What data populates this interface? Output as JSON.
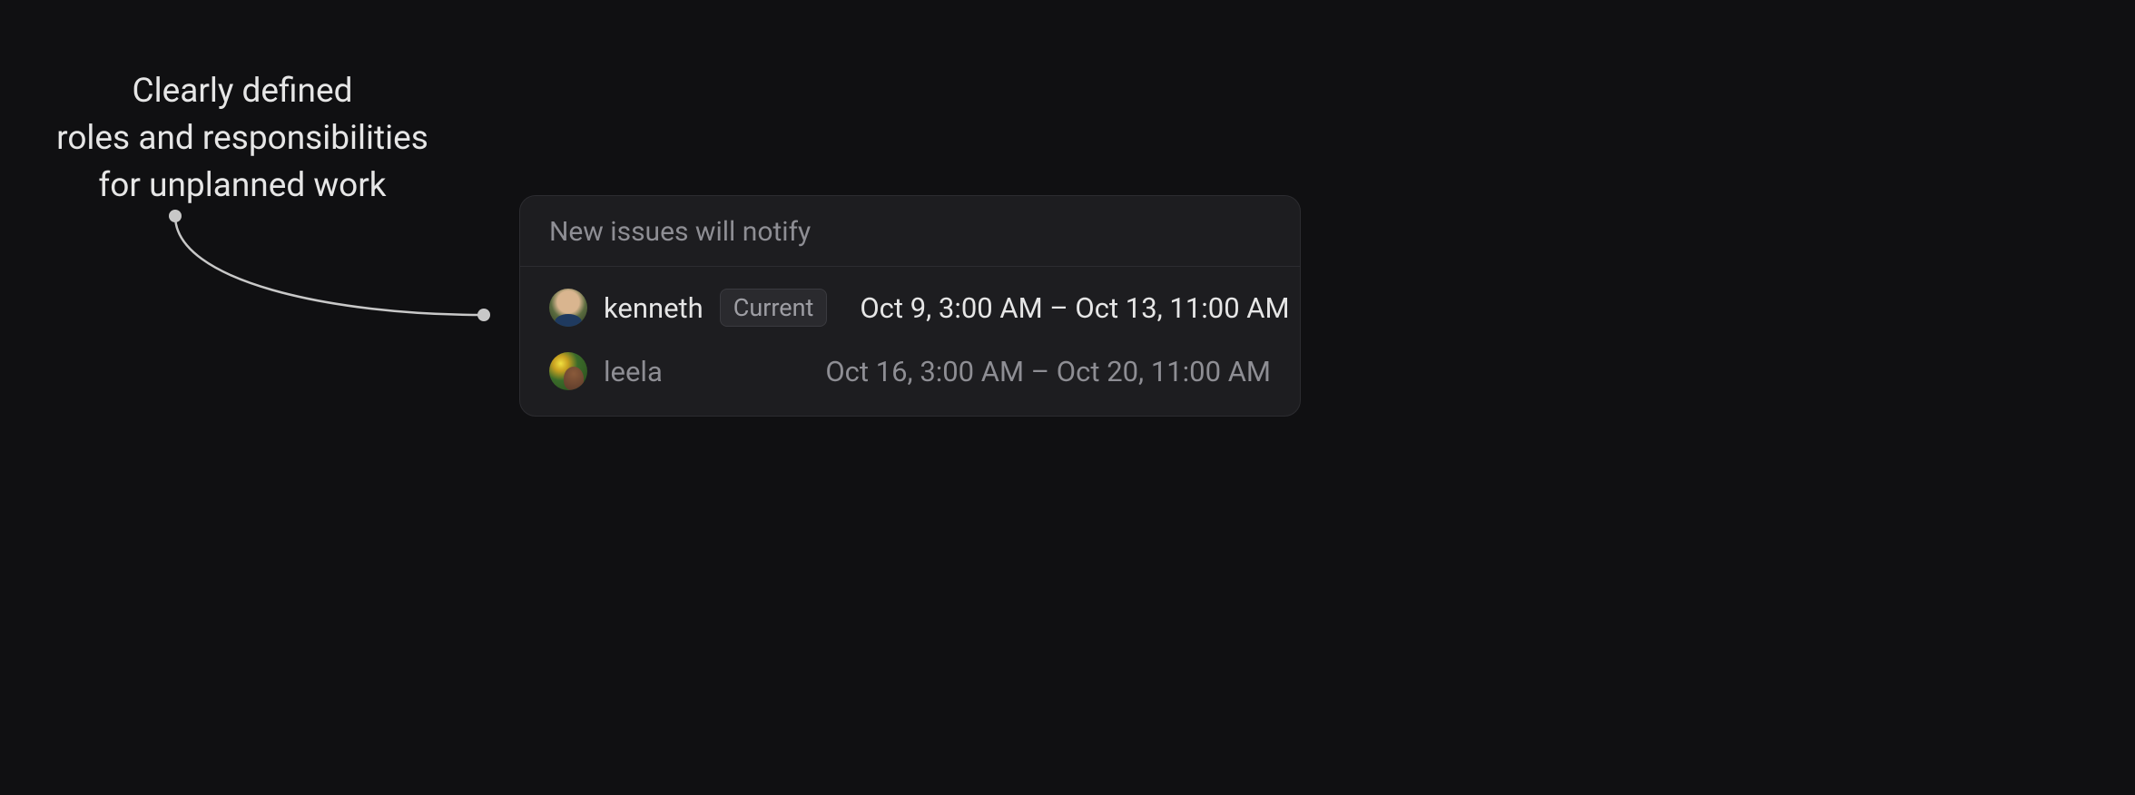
{
  "annotation": {
    "line1": "Clearly defined",
    "line2": "roles and responsibilities",
    "line3": "for unplanned work"
  },
  "panel": {
    "header": "New issues will notify",
    "rows": [
      {
        "avatar": "kenneth",
        "name": "kenneth",
        "badge": "Current",
        "schedule": "Oct 9, 3:00 AM – Oct 13, 11:00 AM",
        "active": true
      },
      {
        "avatar": "leela",
        "name": "leela",
        "badge": null,
        "schedule": "Oct 16, 3:00 AM – Oct 20, 11:00 AM",
        "active": false
      }
    ]
  }
}
